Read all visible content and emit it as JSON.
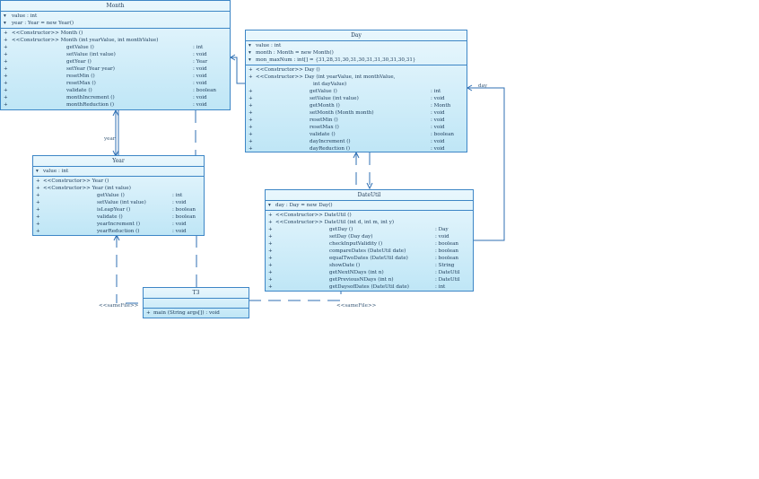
{
  "classes": {
    "month": {
      "name": "Month",
      "attributes": [
        [
          "▾",
          "value  : int",
          ""
        ],
        [
          "▾",
          "year   : Year   = new Year()",
          ""
        ]
      ],
      "methods": [
        [
          "+",
          "<<Constructor>>  Month ()",
          ""
        ],
        [
          "+",
          "<<Constructor>>  Month (int yearValue, int monthValue)",
          ""
        ],
        [
          "+",
          "getValue ()",
          ": int"
        ],
        [
          "+",
          "setValue (int value)",
          ": void"
        ],
        [
          "+",
          "getYear ()",
          ": Year"
        ],
        [
          "+",
          "setYear (Year year)",
          ": void"
        ],
        [
          "+",
          "resetMin ()",
          ": void"
        ],
        [
          "+",
          "resetMax ()",
          ": void"
        ],
        [
          "+",
          "validate ()",
          ": boolean"
        ],
        [
          "+",
          "monthIncrement ()",
          ": void"
        ],
        [
          "+",
          "monthReduction ()",
          ": void"
        ]
      ]
    },
    "day": {
      "name": "Day",
      "attributes": [
        [
          "▾",
          "value       : int",
          ""
        ],
        [
          "▾",
          "month       : Month    = new Month()",
          ""
        ],
        [
          "▾",
          "mon_maxNum  : int[]    = {31,28,31,30,31,30,31,31,30,31,30,31}",
          ""
        ]
      ],
      "methods": [
        [
          "+",
          "<<Constructor>>  Day ()",
          ""
        ],
        [
          "+",
          "<<Constructor>>  Day (int yearValue, int monthValue,",
          ""
        ],
        [
          " ",
          "int dayValue)",
          ""
        ],
        [
          "+",
          "getValue ()",
          ": int"
        ],
        [
          "+",
          "setValue (int value)",
          ": void"
        ],
        [
          "+",
          "getMonth ()",
          ": Month"
        ],
        [
          "+",
          "setMonth (Month month)",
          ": void"
        ],
        [
          "+",
          "resetMin ()",
          ": void"
        ],
        [
          "+",
          "resetMax ()",
          ": void"
        ],
        [
          "+",
          "validate ()",
          ": boolean"
        ],
        [
          "+",
          "dayIncrement ()",
          ": void"
        ],
        [
          "+",
          "dayReduction ()",
          ": void"
        ]
      ]
    },
    "year": {
      "name": "Year",
      "attributes": [
        [
          "▾",
          "value  : int",
          ""
        ]
      ],
      "methods": [
        [
          "+",
          "<<Constructor>>  Year ()",
          ""
        ],
        [
          "+",
          "<<Constructor>>  Year (int value)",
          ""
        ],
        [
          "+",
          "getValue ()",
          ": int"
        ],
        [
          "+",
          "setValue (int value)",
          ": void"
        ],
        [
          "+",
          "isLeapYear ()",
          ": boolean"
        ],
        [
          "+",
          "validate ()",
          ": boolean"
        ],
        [
          "+",
          "yearIncrement ()",
          ": void"
        ],
        [
          "+",
          "yearReduction ()",
          ": void"
        ]
      ]
    },
    "dateutil": {
      "name": "DateUtil",
      "attributes": [
        [
          "▾",
          "day  : Day   = new Day()",
          ""
        ]
      ],
      "methods": [
        [
          "+",
          "<<Constructor>>  DateUtil ()",
          ""
        ],
        [
          "+",
          "<<Constructor>>  DateUtil (int d, int m, int y)",
          ""
        ],
        [
          "+",
          "getDay ()",
          ": Day"
        ],
        [
          "+",
          "setDay (Day day)",
          ": void"
        ],
        [
          "+",
          "checkInputValidity ()",
          ": boolean"
        ],
        [
          "+",
          "compareDates (DateUtil date)",
          ": boolean"
        ],
        [
          "+",
          "equalTwoDates (DateUtil date)",
          ": boolean"
        ],
        [
          "+",
          "showDate ()",
          ": String"
        ],
        [
          "+",
          "getNextNDays (int n)",
          ": DateUtil"
        ],
        [
          "+",
          "getPreviousNDays (int n)",
          ": DateUtil"
        ],
        [
          "+",
          "getDaysofDates (DateUtil date)",
          ": int"
        ]
      ]
    },
    "t3": {
      "name": "T3",
      "attributes": [],
      "methods": [
        [
          "+",
          "main (String args[])  : void",
          ""
        ]
      ]
    }
  },
  "labels": {
    "year_assoc": "year",
    "day_assoc": "day",
    "samefile_left": "<<sameFile>>",
    "samefile_right": "<<sameFile>>"
  },
  "colors": {
    "border": "#3d86c6",
    "line": "#2f6fb3",
    "fill_top": "#e9f7fd",
    "fill_bottom": "#bfe6f6"
  }
}
